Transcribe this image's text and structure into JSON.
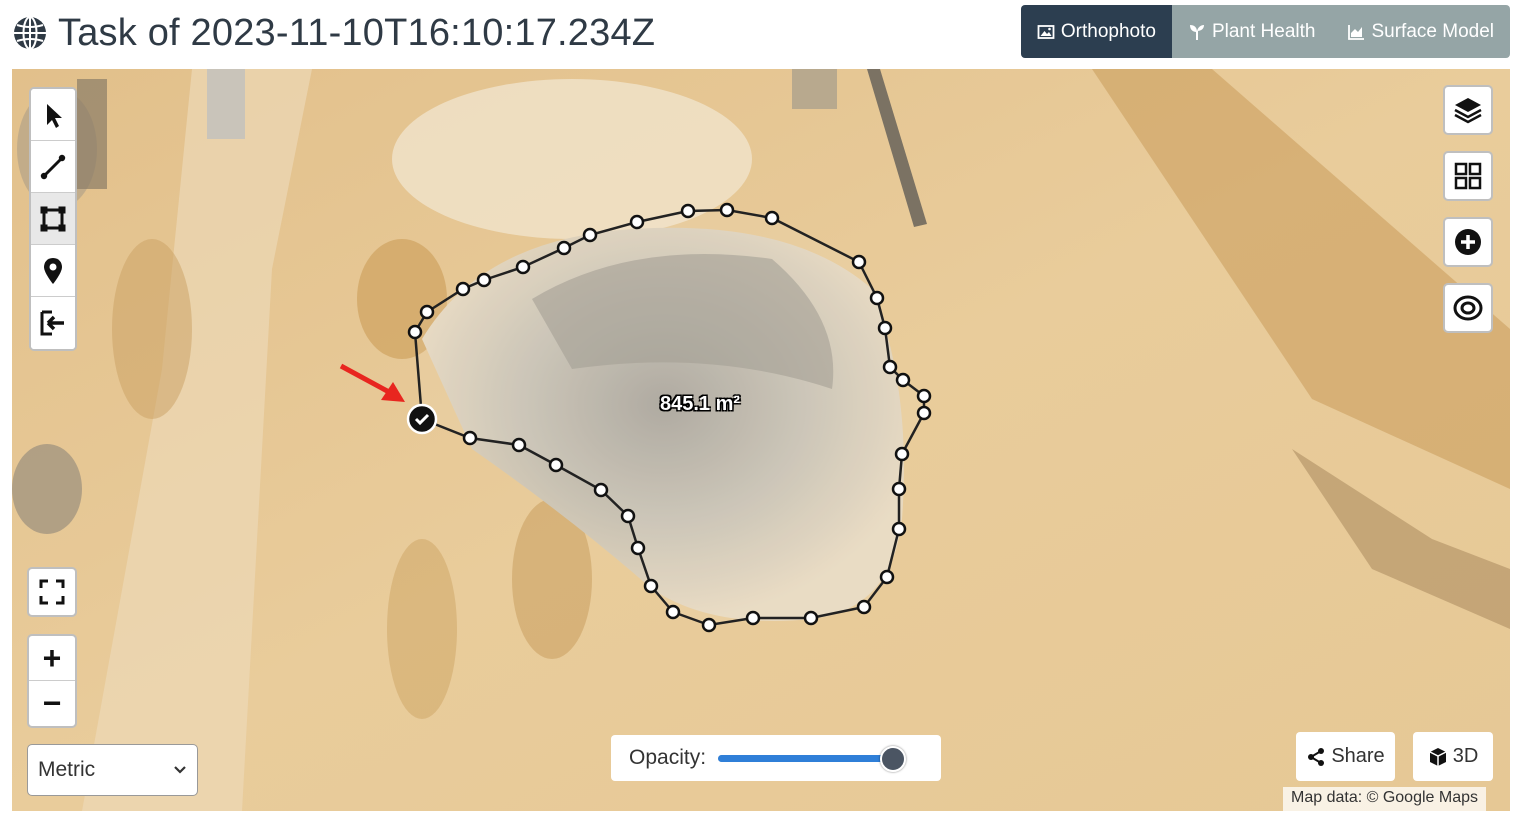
{
  "header": {
    "title": "Task of 2023-11-10T16:10:17.234Z",
    "layer_tabs": [
      {
        "label": "Orthophoto",
        "icon": "image-icon",
        "active": true
      },
      {
        "label": "Plant Health",
        "icon": "plant-icon",
        "active": false
      },
      {
        "label": "Surface Model",
        "icon": "area-chart-icon",
        "active": false
      }
    ]
  },
  "map": {
    "draw_tools": [
      "pointer-icon",
      "measure-line-icon",
      "measure-area-icon",
      "marker-icon",
      "exit-icon"
    ],
    "active_tool": "measure-area-icon",
    "measurement_label": "845.1 m²",
    "right_controls": [
      "layers-icon",
      "grid-icon",
      "plus-circle-icon",
      "target-icon"
    ],
    "zoom_in_label": "+",
    "zoom_out_label": "−",
    "units_selected": "Metric",
    "opacity": {
      "label": "Opacity:",
      "value": 1.0
    },
    "share_label": "Share",
    "threed_label": "3D",
    "attribution": "Map data: © Google Maps",
    "colors": {
      "active_tab": "#2c3e50",
      "inactive_tab": "#95a5a6",
      "slider_fill": "#2f7fd8",
      "annotation_arrow": "#e8261f"
    }
  }
}
